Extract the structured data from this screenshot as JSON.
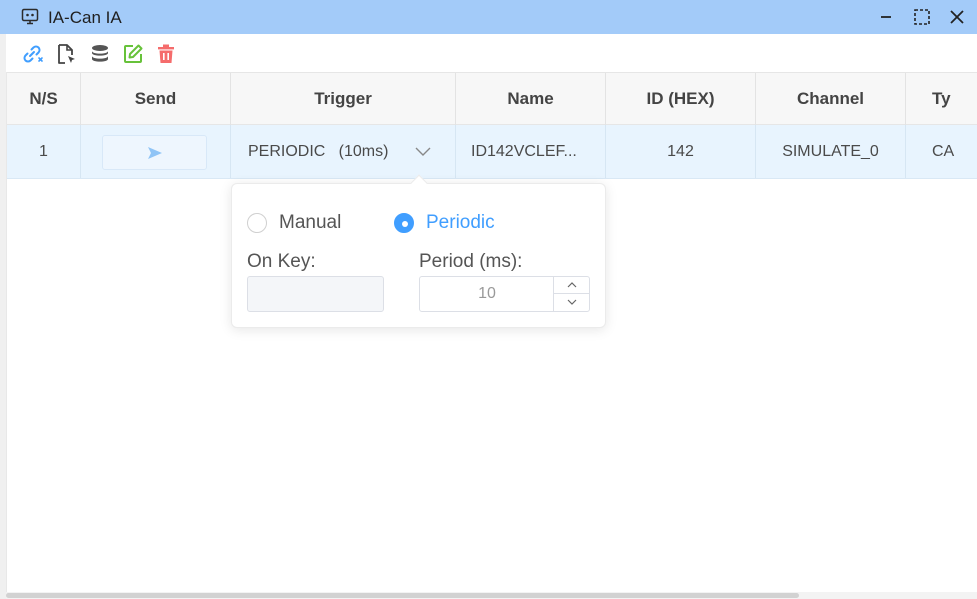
{
  "window": {
    "title": "IA-Can IA",
    "icon": "monitor-robot-icon",
    "controls": [
      "minimize-icon",
      "maximize-icon",
      "close-icon"
    ]
  },
  "toolbar": {
    "buttons": [
      {
        "name": "link-icon",
        "color": "#409eff"
      },
      {
        "name": "file-cursor-icon",
        "color": "#555555"
      },
      {
        "name": "database-icon",
        "color": "#555555"
      },
      {
        "name": "edit-icon",
        "color": "#67c23a"
      },
      {
        "name": "trash-icon",
        "color": "#f56c6c"
      }
    ]
  },
  "table": {
    "columns": [
      "N/S",
      "Send",
      "Trigger",
      "Name",
      "ID (HEX)",
      "Channel",
      "Ty"
    ],
    "rows": [
      {
        "ns": "1",
        "send_icon": "send-arrow-icon",
        "trigger": "PERIODIC   (10ms)",
        "name": "ID142VCLEF...",
        "id_hex": "142",
        "channel": "SIMULATE_0",
        "type": "CA"
      }
    ]
  },
  "trigger_popover": {
    "options": [
      {
        "label": "Manual",
        "selected": false
      },
      {
        "label": "Periodic",
        "selected": true
      }
    ],
    "on_key_label": "On Key:",
    "on_key_value": "",
    "period_label": "Period (ms):",
    "period_value": "10"
  },
  "colors": {
    "accent": "#409eff",
    "titlebar": "#a3cbf9",
    "row_selected": "#e8f4fe"
  }
}
